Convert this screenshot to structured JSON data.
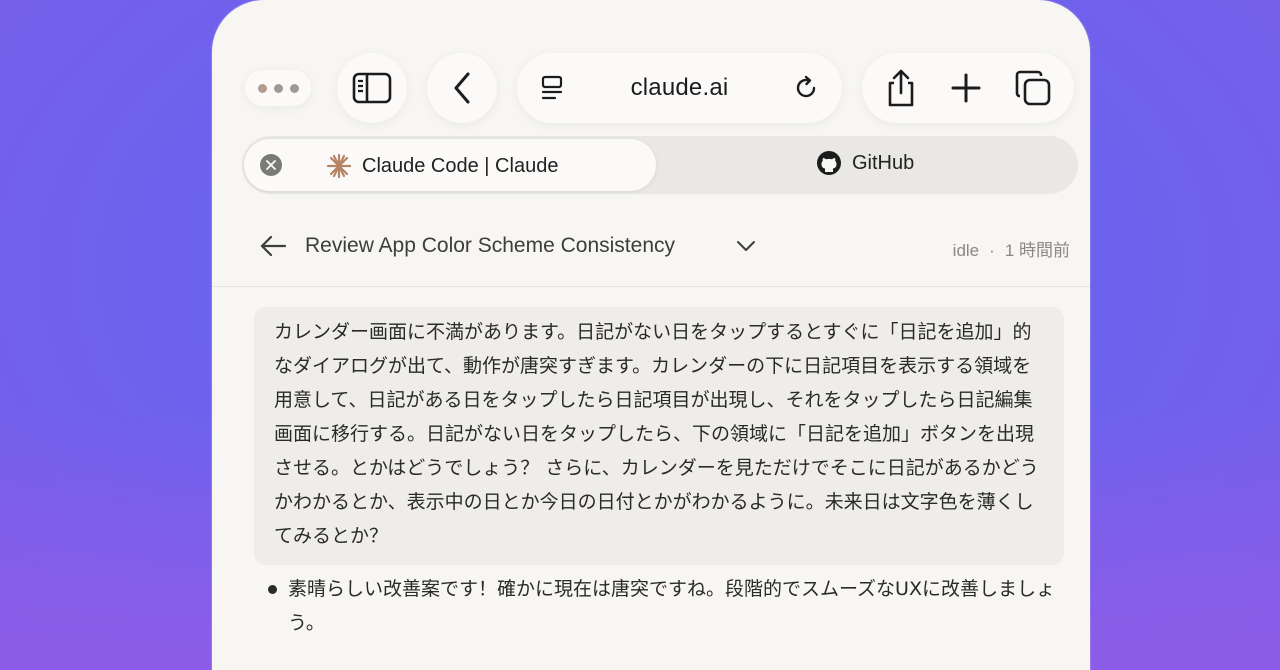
{
  "browser": {
    "url": "claude.ai",
    "tabs": [
      {
        "title": "Claude Code | Claude",
        "icon": "claude-spark-icon",
        "active": true
      },
      {
        "title": "GitHub",
        "icon": "github-icon",
        "active": false
      }
    ]
  },
  "session": {
    "title": "Review App Color Scheme Consistency",
    "status": "idle",
    "separator": "·",
    "time": "1 時間前"
  },
  "conversation": {
    "user_message": "カレンダー画面に不満があります。日記がない日をタップするとすぐに「日記を追加」的なダイアログが出て、動作が唐突すぎます。カレンダーの下に日記項目を表示する領域を用意して、日記がある日をタップしたら日記項目が出現し、それをタップしたら日記編集画面に移行する。日記がない日をタップしたら、下の領域に「日記を追加」ボタンを出現させる。とかはどうでしょう？ さらに、カレンダーを見ただけでそこに日記があるかどうかわかるとか、表示中の日とか今日の日付とかがわかるように。未来日は文字色を薄くしてみるとか？",
    "assistant_reply": "素晴らしい改善案です！確かに現在は唐突ですね。段階的でスムーズなUXに改善しましょう。"
  },
  "colors": {
    "background": "#6a63ee",
    "panel": "#f7f6f3",
    "message_bg": "#efede9",
    "claude_accent": "#c96a4a"
  }
}
